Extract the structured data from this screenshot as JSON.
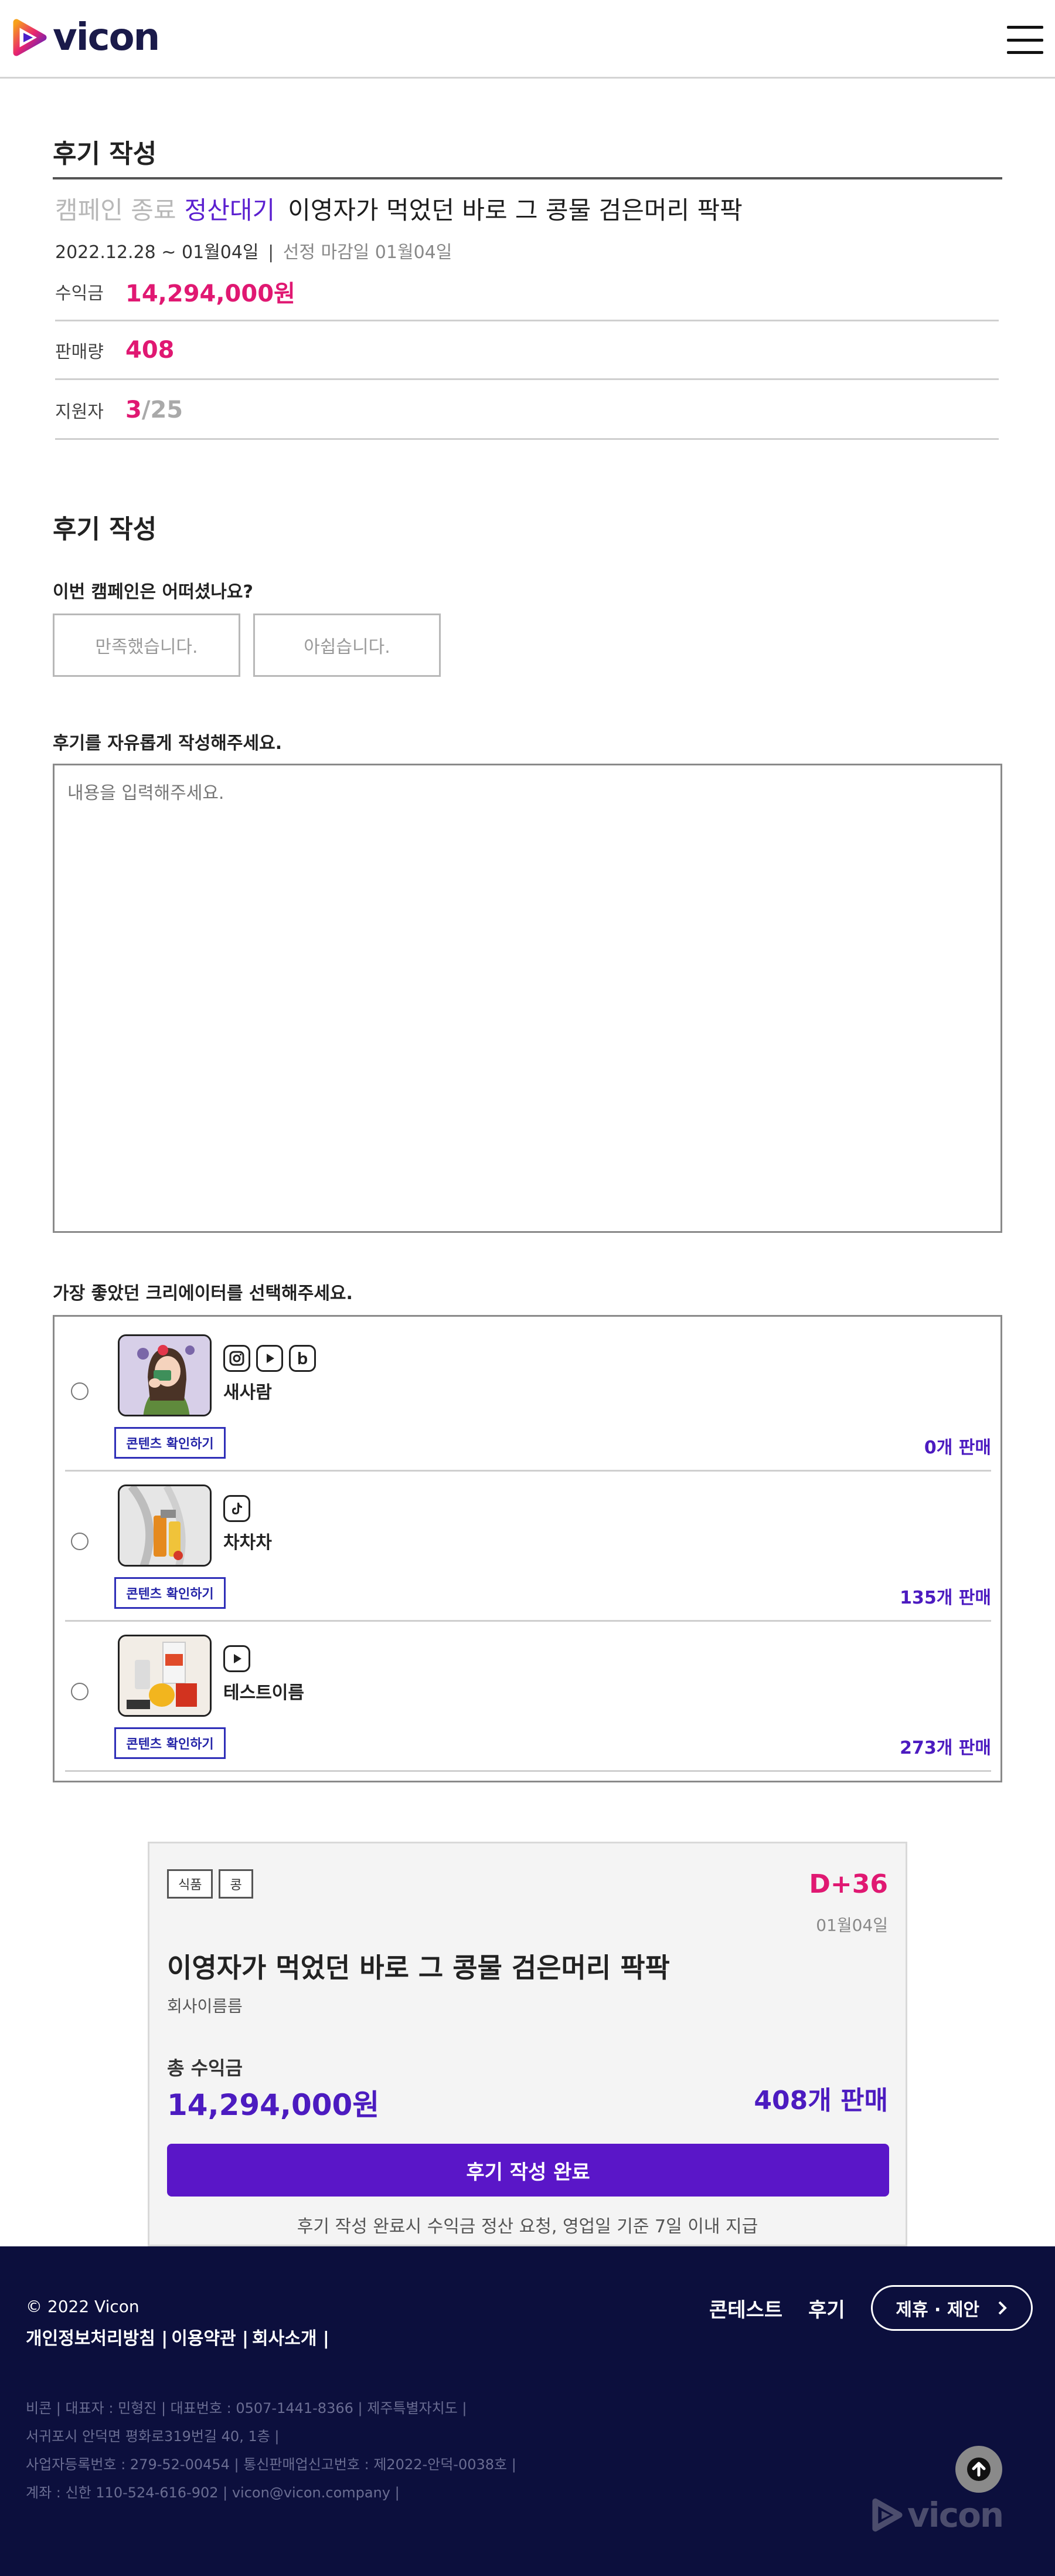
{
  "header": {
    "logo_text": "vicon",
    "menu_icon": "hamburger-menu-icon"
  },
  "summary": {
    "section_title": "후기 작성",
    "status_ended": "캠페인 종료",
    "status_settle": "정산대기",
    "campaign_title": "이영자가 먹었던 바로 그 콩물 검은머리 팍팍",
    "period": "2022.12.28 ~ 01월04일",
    "period_sep": "|",
    "deadline": "선정 마감일 01월04일",
    "stats": [
      {
        "label": "수익금",
        "value": "14,294,000원"
      },
      {
        "label": "판매량",
        "value": "408"
      },
      {
        "label": "지원자",
        "value_current": "3",
        "value_total": "/25"
      }
    ]
  },
  "review": {
    "section_title": "후기 작성",
    "question": "이번 캠페인은 어떠셨나요?",
    "choice_yes": "만족했습니다.",
    "choice_no": "아쉽습니다.",
    "text_label": "후기를 자유롭게 작성해주세요.",
    "text_placeholder": "내용을 입력해주세요.",
    "creator_label": "가장 좋았던 크리에이터를 선택해주세요.",
    "content_button_label": "콘텐츠 확인하기",
    "creators": [
      {
        "name": "새사람",
        "platforms": [
          "instagram-icon",
          "youtube-icon",
          "blog-icon"
        ],
        "sales": "0개 판매"
      },
      {
        "name": "차차차",
        "platforms": [
          "tiktok-icon"
        ],
        "sales": "135개 판매"
      },
      {
        "name": "테스트이름",
        "platforms": [
          "youtube-icon"
        ],
        "sales": "273개 판매"
      }
    ]
  },
  "card": {
    "tags": [
      "식품",
      "콩"
    ],
    "dday": "D+36",
    "date": "01월04일",
    "title": "이영자가 먹었던 바로 그 콩물 검은머리 팍팍",
    "company": "회사이름름",
    "total_label": "총 수익금",
    "total_value": "14,294,000원",
    "total_sales": "408개 판매",
    "submit_label": "후기 작성 완료",
    "notice": "후기 작성 완료시 수익금 정산 요청, 영업일 기준 7일 이내 지급"
  },
  "footer": {
    "copyright": "© 2022 Vicon",
    "policy_links": [
      "개인정보처리방침 |",
      "이용약관 |",
      "회사소개 |"
    ],
    "nav_contest": "콘테스트",
    "nav_review": "후기",
    "partner_label": "제휴 · 제안",
    "info_lines": [
      "비콘 | 대표자 : 민형진 | 대표번호 : 0507-1441-8366 | 제주특별자치도 |",
      "서귀포시 안덕면 평화로319번길 40, 1층 |",
      "사업자등록번호 : 279-52-00454 | 통신판매업신고번호 : 제2022-안덕-0038호 |",
      "계좌 : 신한 110-524-616-902 | vicon@vicon.company |"
    ],
    "logo_text": "vicon"
  },
  "colors": {
    "accent_pink": "#e01872",
    "accent_purple": "#4c1bc0",
    "button_purple": "#5a16c8",
    "footer_bg": "#0c0f3d"
  }
}
